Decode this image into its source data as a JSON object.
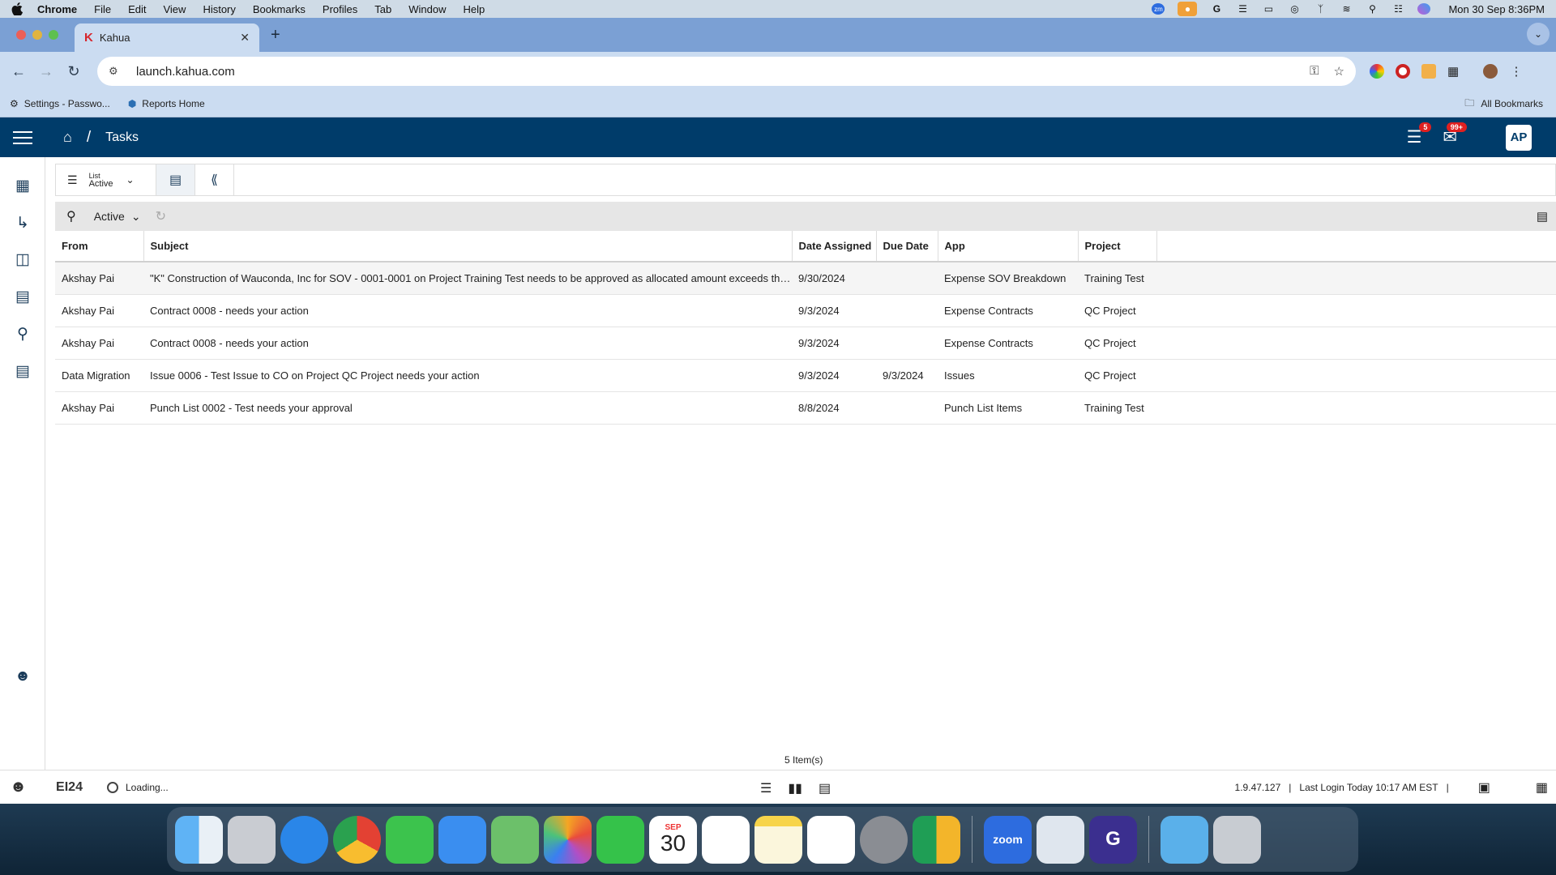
{
  "menubar": {
    "app_name": "Chrome",
    "items": [
      "File",
      "Edit",
      "View",
      "History",
      "Bookmarks",
      "Profiles",
      "Tab",
      "Window",
      "Help"
    ],
    "clock": "Mon 30 Sep  8:36PM"
  },
  "browser": {
    "tab_title": "Kahua",
    "url": "launch.kahua.com",
    "bookmarks": [
      {
        "label": "Settings - Passwo...",
        "icon": "gear-icon"
      },
      {
        "label": "Reports Home",
        "icon": "cube-icon"
      }
    ],
    "all_bookmarks": "All Bookmarks"
  },
  "app": {
    "page_title": "Tasks",
    "notifications": {
      "tasks_badge": "5",
      "mail_badge": "99+"
    },
    "avatar_initials": "AP",
    "view": {
      "label_small": "List",
      "label_big": "Active"
    },
    "filter": {
      "selected": "Active"
    },
    "table": {
      "columns": [
        "From",
        "Subject",
        "Date Assigned",
        "Due Date",
        "App",
        "Project"
      ],
      "rows": [
        [
          "Akshay Pai",
          "\"K\" Construction of Wauconda, Inc for SOV - 0001-0001 on Project Training Test needs to be approved as allocated amount  exceeds the line item budget",
          "9/30/2024",
          "",
          "Expense SOV Breakdown",
          "Training Test"
        ],
        [
          "Akshay Pai",
          "Contract 0008 -  needs your action",
          "9/3/2024",
          "",
          "Expense Contracts",
          "QC Project"
        ],
        [
          "Akshay Pai",
          "Contract 0008 -  needs your action",
          "9/3/2024",
          "",
          "Expense Contracts",
          "QC Project"
        ],
        [
          "Data Migration",
          "Issue 0006 - Test Issue to CO on Project QC Project needs your action",
          "9/3/2024",
          "9/3/2024",
          "Issues",
          "QC Project"
        ],
        [
          "Akshay Pai",
          "Punch List 0002 - Test needs your approval",
          "8/8/2024",
          "",
          "Punch List Items",
          "Training Test"
        ]
      ]
    },
    "item_count": "5  Item(s)",
    "status": {
      "logo": "EI24",
      "loading": "Loading...",
      "version": "1.9.47.127",
      "last_login": "Last Login Today 10:17 AM EST"
    }
  },
  "dock": {
    "calendar_month": "SEP",
    "calendar_day": "30",
    "zoom_label": "zoom"
  },
  "colors": {
    "app_header": "#003c6a",
    "chrome_tabstrip": "#7ba0d4",
    "chrome_toolbar": "#cbdcf1",
    "badge": "#e02020"
  }
}
